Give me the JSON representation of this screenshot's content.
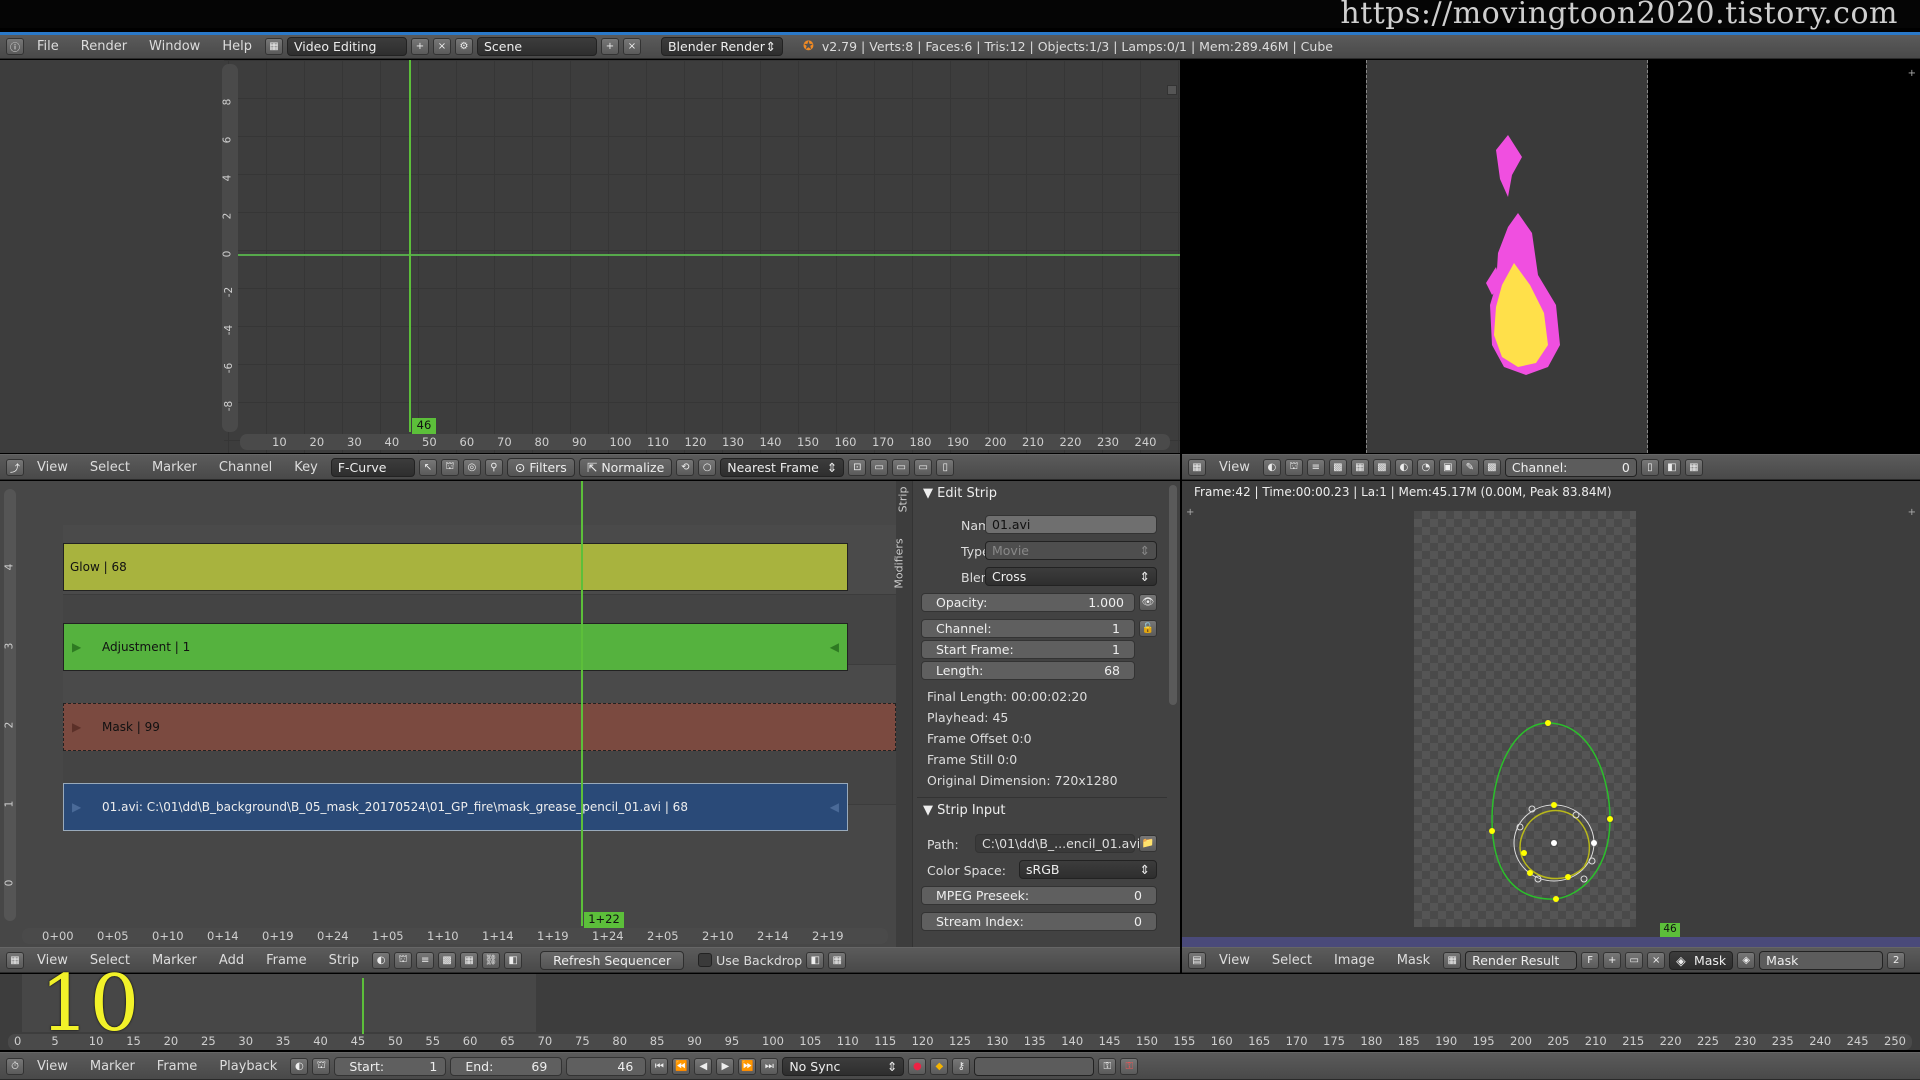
{
  "watermark": "https://movingtoon2020.tistory.com",
  "info_header": {
    "menus": [
      "File",
      "Render",
      "Window",
      "Help"
    ],
    "screen_layout": "Video Editing",
    "scene": "Scene",
    "render_engine": "Blender Render",
    "stats": "v2.79 | Verts:8 | Faces:6 | Tris:12 | Objects:1/3 | Lamps:0/1 | Mem:289.46M | Cube"
  },
  "graph_editor": {
    "y_ticks": [
      "8",
      "6",
      "4",
      "2",
      "0",
      "-2",
      "-4",
      "-6",
      "-8"
    ],
    "x_ticks": [
      "10",
      "20",
      "30",
      "40",
      "50",
      "60",
      "70",
      "80",
      "90",
      "100",
      "110",
      "120",
      "130",
      "140",
      "150",
      "160",
      "170",
      "180",
      "190",
      "200",
      "210",
      "220",
      "230",
      "240"
    ],
    "current_frame": "46",
    "header": {
      "menus": [
        "View",
        "Select",
        "Marker",
        "Channel",
        "Key"
      ],
      "mode": "F-Curve",
      "filters": "Filters",
      "normalize": "Normalize",
      "snap": "Nearest Frame"
    }
  },
  "preview": {
    "header": {
      "menu": "View",
      "channel_label": "Channel:",
      "channel_value": "0"
    }
  },
  "sequencer": {
    "channel_numbers": [
      "4",
      "3",
      "2",
      "1",
      "0"
    ],
    "strips": [
      {
        "label": "Glow | 68",
        "color": "#a8b33e"
      },
      {
        "label": "Adjustment | 1",
        "color": "#55b23e"
      },
      {
        "label": "Mask | 99",
        "color": "#7b4a40"
      },
      {
        "label": "01.avi: C:\\01\\dd\\B_background\\B_05_mask_20170524\\01_GP_fire\\mask_grease_pencil_01.avi | 68",
        "color": "#2a4a78"
      }
    ],
    "time_ticks": [
      "0+00",
      "0+05",
      "0+10",
      "0+14",
      "0+19",
      "0+24",
      "1+05",
      "1+10",
      "1+14",
      "1+19",
      "1+24",
      "2+05",
      "2+10",
      "2+14",
      "2+19"
    ],
    "current_time": "1+22",
    "tabs": [
      "Strip",
      "Modifiers"
    ],
    "header": {
      "menus": [
        "View",
        "Select",
        "Marker",
        "Add",
        "Frame",
        "Strip"
      ],
      "refresh": "Refresh Sequencer",
      "use_backdrop": "Use Backdrop"
    }
  },
  "properties": {
    "edit_strip": {
      "title": "Edit Strip",
      "name_label": "Name:",
      "name": "01.avi",
      "type_label": "Type:",
      "type": "Movie",
      "blend_label": "Blend:",
      "blend": "Cross",
      "opacity_label": "Opacity:",
      "opacity": "1.000",
      "channel_label": "Channel:",
      "channel": "1",
      "start_label": "Start Frame:",
      "start": "1",
      "length_label": "Length:",
      "length": "68",
      "final_length": "Final Length: 00:00:02:20",
      "playhead": "Playhead: 45",
      "frame_offset": "Frame Offset 0:0",
      "frame_still": "Frame Still 0:0",
      "orig_dim": "Original Dimension: 720x1280"
    },
    "strip_input": {
      "title": "Strip Input",
      "path_label": "Path:",
      "path": "C:\\01\\dd\\B_...encil_01.avi",
      "colorspace_label": "Color Space:",
      "colorspace": "sRGB",
      "mpeg_label": "MPEG Preseek:",
      "mpeg": "0",
      "stream_label": "Stream Index:",
      "stream": "0"
    }
  },
  "image_editor": {
    "info": "Frame:42 | Time:00:00.23 | La:1 | Mem:45.17M (0.00M, Peak 83.84M)",
    "frame_badge": "46",
    "header": {
      "menus": [
        "View",
        "Select",
        "Image",
        "Mask"
      ],
      "image": "Render Result",
      "f_label": "F",
      "mode": "Mask",
      "mask_name": "Mask",
      "number": "2"
    }
  },
  "timeline": {
    "big_frame": "10",
    "ticks": [
      "0",
      "5",
      "10",
      "15",
      "20",
      "25",
      "30",
      "35",
      "40",
      "45",
      "50",
      "55",
      "60",
      "65",
      "70",
      "75",
      "80",
      "85",
      "90",
      "95",
      "100",
      "105",
      "110",
      "115",
      "120",
      "125",
      "130",
      "135",
      "140",
      "145",
      "150",
      "155",
      "160",
      "165",
      "170",
      "175",
      "180",
      "185",
      "190",
      "195",
      "200",
      "205",
      "210",
      "215",
      "220",
      "225",
      "230",
      "235",
      "240",
      "245",
      "250"
    ],
    "header": {
      "menus": [
        "View",
        "Marker",
        "Frame",
        "Playback"
      ],
      "start_label": "Start:",
      "start": "1",
      "end_label": "End:",
      "end": "69",
      "current": "46",
      "sync": "No Sync"
    }
  }
}
